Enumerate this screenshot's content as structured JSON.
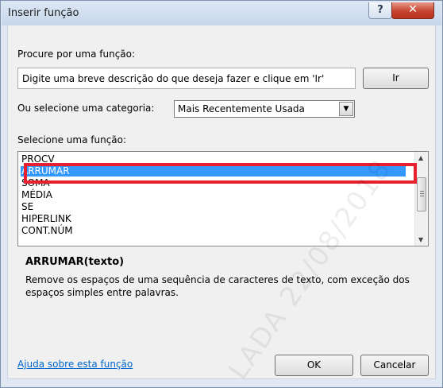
{
  "window": {
    "title": "Inserir função",
    "help_glyph": "?",
    "close_glyph": "✕"
  },
  "search": {
    "label": "Procure por uma função:",
    "placeholder": "Digite uma breve descrição do que deseja fazer e clique em 'Ir'",
    "go_button": "Ir"
  },
  "category": {
    "label": "Ou selecione uma categoria:",
    "selected": "Mais Recentemente Usada"
  },
  "functions": {
    "label": "Selecione uma função:",
    "items": [
      "PROCV",
      "ARRUMAR",
      "SOMA",
      "MÉDIA",
      "SE",
      "HIPERLINK",
      "CONT.NÚM"
    ],
    "selected": "ARRUMAR"
  },
  "details": {
    "signature": "ARRUMAR(texto)",
    "description": "Remove os espaços de uma sequência de caracteres de texto, com exceção dos espaços simples entre palavras."
  },
  "footer": {
    "help_link": "Ajuda sobre esta função",
    "ok_button": "OK",
    "cancel_button": "Cancelar"
  },
  "watermark": "LADA 22/08/2018",
  "colors": {
    "selection": "#3399ff",
    "highlight_box": "#e8202e",
    "close_button": "#c6452f",
    "link": "#0066cc"
  }
}
